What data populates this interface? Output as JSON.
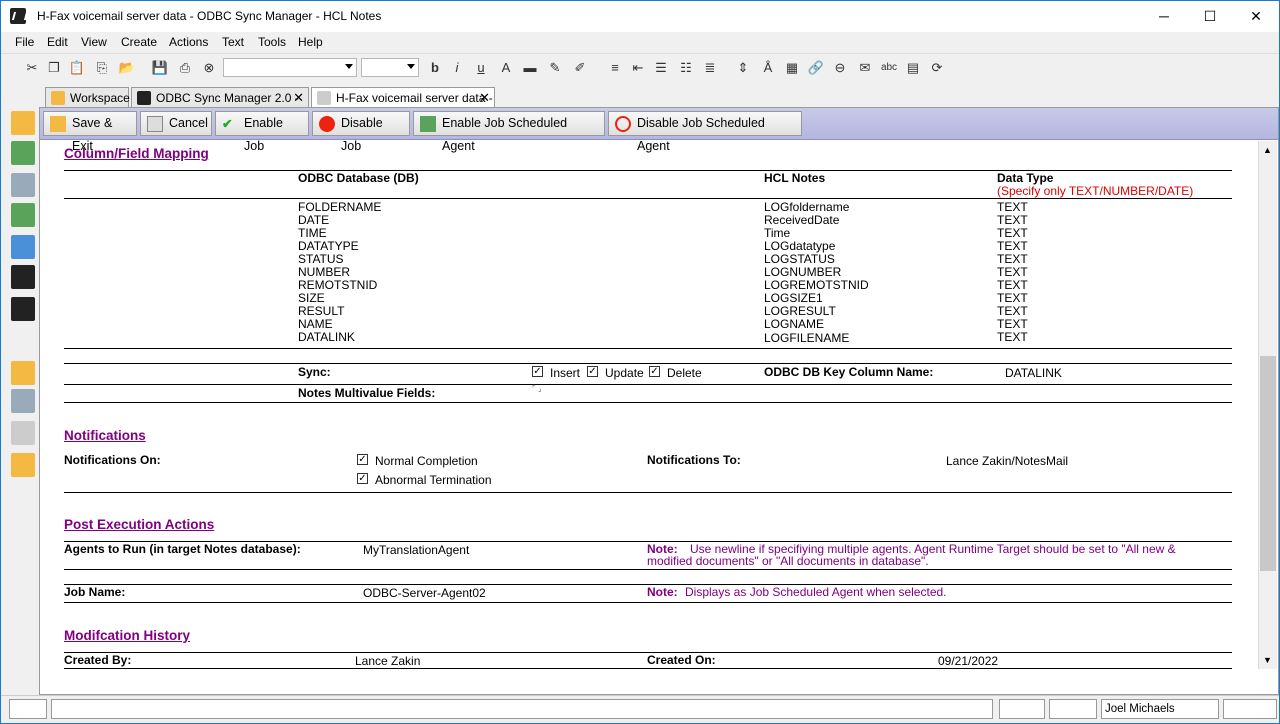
{
  "window": {
    "title": "H-Fax voicemail server data - ODBC Sync Manager - HCL Notes",
    "minimize": "─",
    "maximize": "☐",
    "close": "✕"
  },
  "menu": [
    "File",
    "Edit",
    "View",
    "Create",
    "Actions",
    "Text",
    "Tools",
    "Help"
  ],
  "tabs": [
    {
      "label": "Workspace"
    },
    {
      "label": "ODBC Sync Manager 2.0 - ..."
    },
    {
      "label": "H-Fax voicemail server data - ..."
    }
  ],
  "actions": [
    "Save & Exit",
    "Cancel",
    "Enable Job",
    "Disable Job",
    "Enable Job Scheduled Agent",
    "Disable Job Scheduled Agent"
  ],
  "mapping": {
    "title": "Column/Field Mapping",
    "col_db": "ODBC Database (DB)",
    "col_notes": "HCL Notes",
    "col_type": "Data Type",
    "col_type_note": "(Specify only TEXT/NUMBER/DATE)",
    "db": [
      "FOLDERNAME",
      "DATE",
      "TIME",
      "DATATYPE",
      "STATUS",
      "NUMBER",
      "REMOTSTNID",
      "SIZE",
      "RESULT",
      "NAME",
      "DATALINK"
    ],
    "notes": [
      "LOGfoldername",
      "ReceivedDate",
      "Time",
      "LOGdatatype",
      "LOGSTATUS",
      "LOGNUMBER",
      "LOGREMOTSTNID",
      "LOGSIZE1",
      "LOGRESULT",
      "LOGNAME",
      "LOGFILENAME"
    ],
    "types": [
      "TEXT",
      "TEXT",
      "TEXT",
      "TEXT",
      "TEXT",
      "TEXT",
      "TEXT",
      "TEXT",
      "TEXT",
      "TEXT",
      "TEXT"
    ],
    "sync_label": "Sync:",
    "insert": "Insert",
    "update": "Update",
    "delete": "Delete",
    "key_label": "ODBC DB Key Column Name:",
    "key_value": "DATALINK",
    "multivalue_label": "Notes Multivalue Fields:"
  },
  "notifications": {
    "title": "Notifications",
    "on_label": "Notifications On:",
    "normal": "Normal Completion",
    "abnormal": "Abnormal Termination",
    "to_label": "Notifications To:",
    "to_value": "Lance Zakin/NotesMail"
  },
  "post": {
    "title": "Post Execution Actions",
    "agents_label": "Agents to Run (in target Notes database):",
    "agents_value": "MyTranslationAgent",
    "note_prefix": "Note:",
    "note1_line1": "Use newline if specifiying multiple agents.  Agent Runtime Target should be set to \"All new &",
    "note1_line2": "modified documents\" or \"All documents in database\".",
    "job_label": "Job Name:",
    "job_value": "ODBC-Server-Agent02",
    "note2": "Displays as Job Scheduled Agent when selected."
  },
  "history": {
    "title": "Modifcation History",
    "created_by_label": "Created By:",
    "created_by": "Lance Zakin",
    "created_on_label": "Created On:",
    "created_on": "09/21/2022"
  },
  "status": {
    "user": "Joel Michaels"
  }
}
